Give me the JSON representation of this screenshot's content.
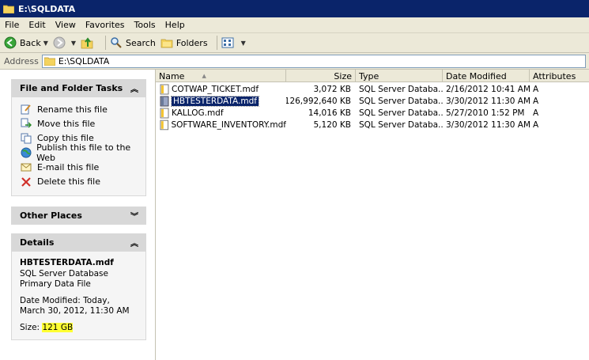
{
  "window": {
    "title": "E:\\SQLDATA"
  },
  "menu": [
    "File",
    "Edit",
    "View",
    "Favorites",
    "Tools",
    "Help"
  ],
  "toolbar": {
    "back": "Back",
    "search": "Search",
    "folders": "Folders"
  },
  "address": {
    "label": "Address",
    "value": "E:\\SQLDATA"
  },
  "tasks": {
    "title": "File and Folder Tasks",
    "items": [
      {
        "label": "Rename this file",
        "icon": "rename-icon"
      },
      {
        "label": "Move this file",
        "icon": "move-icon"
      },
      {
        "label": "Copy this file",
        "icon": "copy-icon"
      },
      {
        "label": "Publish this file to the Web",
        "icon": "publish-web-icon"
      },
      {
        "label": "E-mail this file",
        "icon": "email-icon"
      },
      {
        "label": "Delete this file",
        "icon": "delete-icon"
      }
    ]
  },
  "other_places": {
    "title": "Other Places"
  },
  "details": {
    "title": "Details",
    "name": "HBTESTERDATA.mdf",
    "type": "SQL Server Database Primary Data File",
    "date_modified": "Date Modified: Today, March 30, 2012, 11:30 AM",
    "size_label": "Size:",
    "size_value": "121 GB"
  },
  "columns": [
    "Name",
    "Size",
    "Type",
    "Date Modified",
    "Attributes"
  ],
  "files": [
    {
      "name": "COTWAP_TICKET.mdf",
      "size": "3,072 KB",
      "type": "SQL Server Databa...",
      "date": "2/16/2012 10:41 AM",
      "attr": "A",
      "selected": false
    },
    {
      "name": "HBTESTERDATA.mdf",
      "size": "126,992,640 KB",
      "type": "SQL Server Databa...",
      "date": "3/30/2012 11:30 AM",
      "attr": "A",
      "selected": true
    },
    {
      "name": "KALLOG.mdf",
      "size": "14,016 KB",
      "type": "SQL Server Databa...",
      "date": "5/27/2010 1:52 PM",
      "attr": "A",
      "selected": false
    },
    {
      "name": "SOFTWARE_INVENTORY.mdf",
      "size": "5,120 KB",
      "type": "SQL Server Databa...",
      "date": "3/30/2012 11:30 AM",
      "attr": "A",
      "selected": false
    }
  ],
  "colors": {
    "titlebar": "#0a246a",
    "selection": "#0a246a",
    "highlight": "#ffff33",
    "panel_header": "#d8d8d8"
  }
}
